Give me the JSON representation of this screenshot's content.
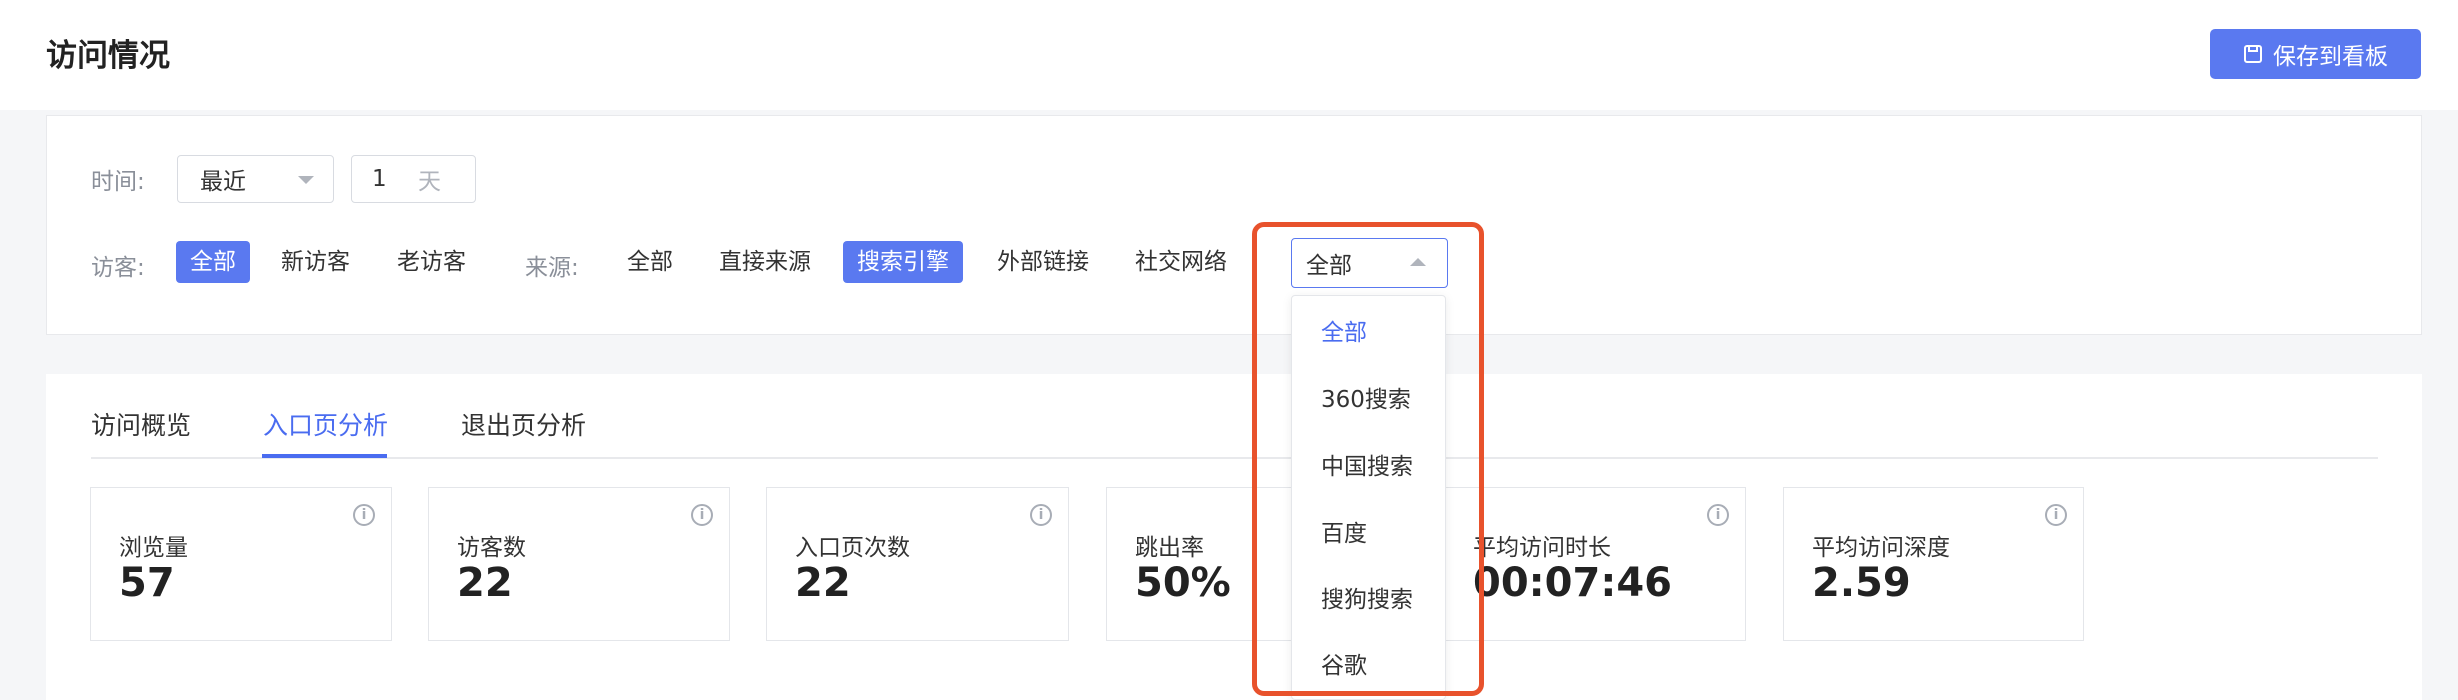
{
  "header": {
    "title": "访问情况",
    "save_button": "保存到看板"
  },
  "filters": {
    "time_label": "时间:",
    "time_select": "最近",
    "time_value": "1",
    "time_unit": "天",
    "visitor_label": "访客:",
    "visitor_options": [
      "全部",
      "新访客",
      "老访客"
    ],
    "source_label": "来源:",
    "source_options": [
      "全部",
      "直接来源",
      "搜索引擎",
      "外部链接",
      "社交网络"
    ],
    "engine_select": "全部"
  },
  "dropdown": {
    "items": [
      "全部",
      "360搜索",
      "中国搜索",
      "百度",
      "搜狗搜索",
      "谷歌"
    ]
  },
  "tabs": [
    "访问概览",
    "入口页分析",
    "退出页分析"
  ],
  "cards": [
    {
      "label": "浏览量",
      "value": "57"
    },
    {
      "label": "访客数",
      "value": "22"
    },
    {
      "label": "入口页次数",
      "value": "22"
    },
    {
      "label": "跳出率",
      "value": "50%"
    },
    {
      "label": "平均访问时长",
      "value": "00:07:46"
    },
    {
      "label": "平均访问深度",
      "value": "2.59"
    }
  ],
  "colors": {
    "primary": "#5a79f0",
    "highlight": "#e8522c"
  }
}
